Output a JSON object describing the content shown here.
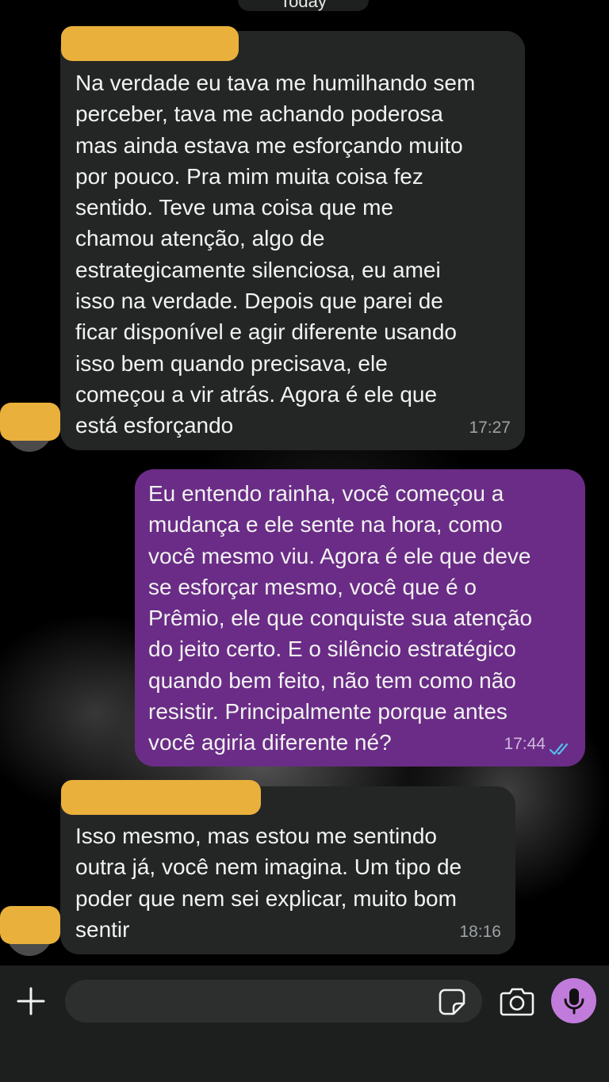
{
  "date_divider": "Today",
  "messages": [
    {
      "direction": "incoming",
      "text": "Na verdade eu tava me humilhando sem\nperceber, tava me achando poderosa\nmas ainda estava me esforçando muito\npor pouco. Pra mim muita coisa fez\nsentido. Teve uma coisa que me\nchamou atenção, algo de\nestrategicamente silenciosa, eu amei\nisso na verdade. Depois que parei de\nficar disponível e agir diferente usando\nisso bem quando precisava, ele\ncomeçou a vir atrás. Agora é ele que\nestá esforçando",
      "time": "17:27"
    },
    {
      "direction": "outgoing",
      "text": "Eu entendo rainha, você começou a\nmudança e ele sente na hora, como\nvocê mesmo viu. Agora é ele que deve\nse esforçar mesmo, você que é o\nPrêmio, ele que conquiste sua atenção\ndo jeito certo. E o silêncio estratégico\nquando bem feito, não tem como não\nresistir. Principalmente porque antes\nvocê agiria diferente né?",
      "time": "17:44",
      "status": "read"
    },
    {
      "direction": "incoming",
      "text": "Isso mesmo, mas estou me sentindo\noutra já, você nem imagina. Um tipo de\npoder que nem sei explicar, muito bom\nsentir",
      "time": "18:16"
    }
  ],
  "composer": {
    "placeholder": "",
    "value": ""
  },
  "icons": {
    "attach": "plus-icon",
    "sticker": "sticker-icon",
    "camera": "camera-icon",
    "mic": "microphone-icon",
    "read_receipt": "double-check-icon"
  },
  "colors": {
    "incoming_bubble": "#242626",
    "outgoing_bubble": "#6a2c86",
    "redaction": "#e9b03b",
    "mic_button": "#c17bdb",
    "read_ticks": "#53bdeb"
  }
}
